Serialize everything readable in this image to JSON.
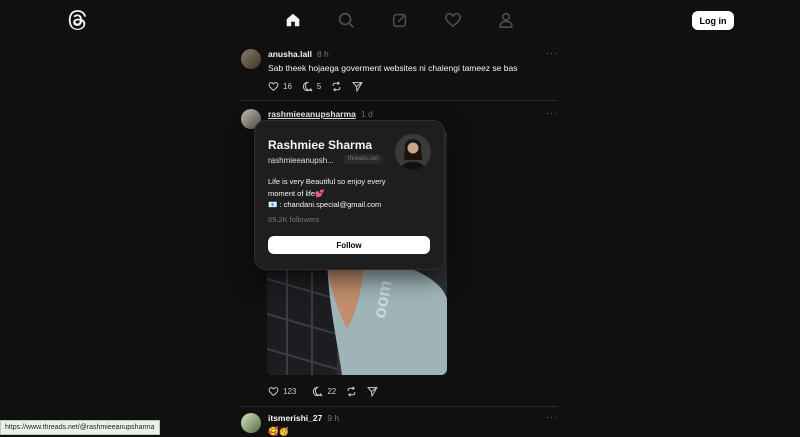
{
  "header": {
    "logo_icon": "threads-logo-icon",
    "nav": [
      "home-icon",
      "search-icon",
      "compose-icon",
      "heart-icon",
      "profile-icon"
    ],
    "login_label": "Log in"
  },
  "posts": [
    {
      "username": "anusha.lall",
      "time": "8 h",
      "more": "···",
      "text": "Sab theek hojaega goverment websites ni chalengi tameez se bas",
      "likes": "16",
      "replies": "5"
    },
    {
      "username": "rashmieeanupsharma",
      "time": "1 d",
      "more": "···",
      "likes": "123",
      "replies": "22"
    },
    {
      "username": "itsmerishi_27",
      "time": "9 h",
      "more": "···",
      "text": "🥰🥳"
    }
  ],
  "profile_card": {
    "name": "Rashmiee Sharma",
    "handle": "rashmieeanupsh...",
    "badge": "threads.net",
    "bio_line1": "Life is very Beautiful so enjoy every",
    "bio_line2": "moment of life💕",
    "bio_line3": "📧 : chandani.special@gmail.com",
    "followers": "69.2K followers",
    "follow_label": "Follow"
  },
  "status_url": "https://www.threads.net/@rashmieeanupsharma"
}
